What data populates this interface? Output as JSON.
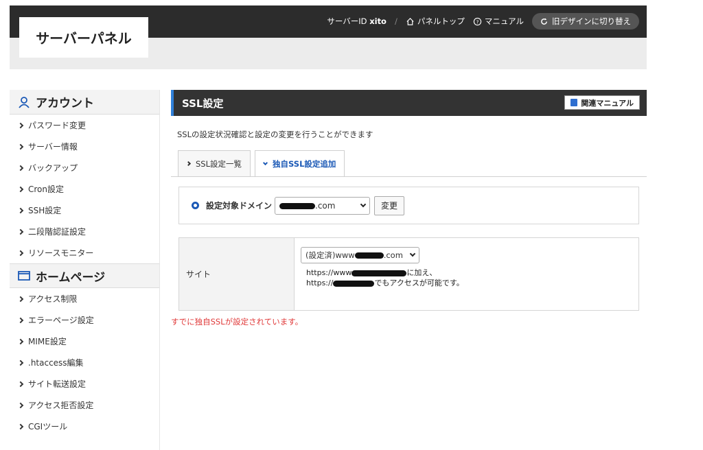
{
  "header": {
    "logo": "サーバーパネル",
    "server_id_label": "サーバーID",
    "server_id_value": "xito",
    "separator": "/",
    "panel_top": "パネルトップ",
    "manual": "マニュアル",
    "old_design": "旧デザインに切り替え"
  },
  "sidebar": {
    "sections": [
      {
        "title": "アカウント",
        "icon": "user-icon",
        "items": [
          "パスワード変更",
          "サーバー情報",
          "バックアップ",
          "Cron設定",
          "SSH設定",
          "二段階認証設定",
          "リソースモニター"
        ]
      },
      {
        "title": "ホームページ",
        "icon": "window-icon",
        "items": [
          "アクセス制限",
          "エラーページ設定",
          "MIME設定",
          ".htaccess編集",
          "サイト転送設定",
          "アクセス拒否設定",
          "CGIツール"
        ]
      }
    ]
  },
  "main": {
    "title": "SSL設定",
    "manual_button": "関連マニュアル",
    "description": "SSLの設定状況確認と設定の変更を行うことができます",
    "tabs": [
      {
        "label": "SSL設定一覧",
        "active": false
      },
      {
        "label": "独自SSL設定追加",
        "active": true
      }
    ],
    "domain_label": "設定対象ドメイン",
    "domain_select_value": ".com",
    "change_button": "変更",
    "site_label": "サイト",
    "site_select_prefix": "(設定済)www",
    "site_select_suffix": ".com",
    "site_note_line1_prefix": "https://www",
    "site_note_line1_suffix": "に加え、",
    "site_note_line2_prefix": "https://",
    "site_note_line2_suffix": "でもアクセスが可能です。",
    "error_message": "すでに独自SSLが設定されています。"
  },
  "colors": {
    "accent_blue": "#1b59b6",
    "title_bar": "#333333",
    "topbar": "#2c2c2c",
    "error": "#e03a3a"
  }
}
